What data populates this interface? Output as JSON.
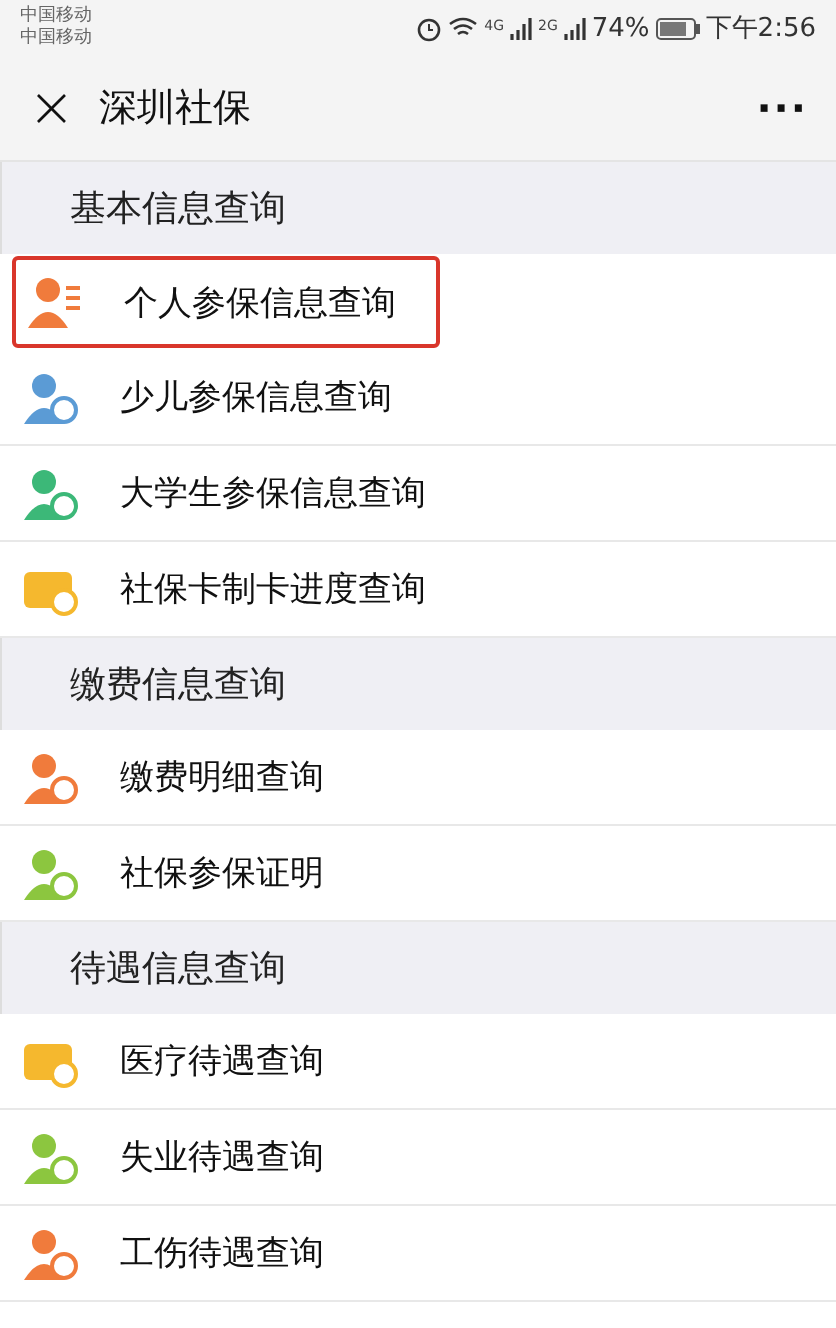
{
  "status_bar": {
    "carriers": [
      "中国移动",
      "中国移动"
    ],
    "network_1": "4G",
    "network_2": "2G",
    "battery": "74%",
    "time": "下午2:56"
  },
  "nav": {
    "close": "×",
    "title": "深圳社保",
    "more": "···"
  },
  "sections": [
    {
      "title": "基本信息查询",
      "items": [
        {
          "label": "个人参保信息查询",
          "selected": true
        },
        {
          "label": "少儿参保信息查询",
          "selected": false
        },
        {
          "label": "大学生参保信息查询",
          "selected": false
        },
        {
          "label": "社保卡制卡进度查询",
          "selected": false
        }
      ]
    },
    {
      "title": "缴费信息查询",
      "items": [
        {
          "label": "缴费明细查询",
          "selected": false
        },
        {
          "label": "社保参保证明",
          "selected": false
        }
      ]
    },
    {
      "title": "待遇信息查询",
      "items": [
        {
          "label": "医疗待遇查询",
          "selected": false
        },
        {
          "label": "失业待遇查询",
          "selected": false
        },
        {
          "label": "工伤待遇查询",
          "selected": false
        }
      ]
    }
  ]
}
